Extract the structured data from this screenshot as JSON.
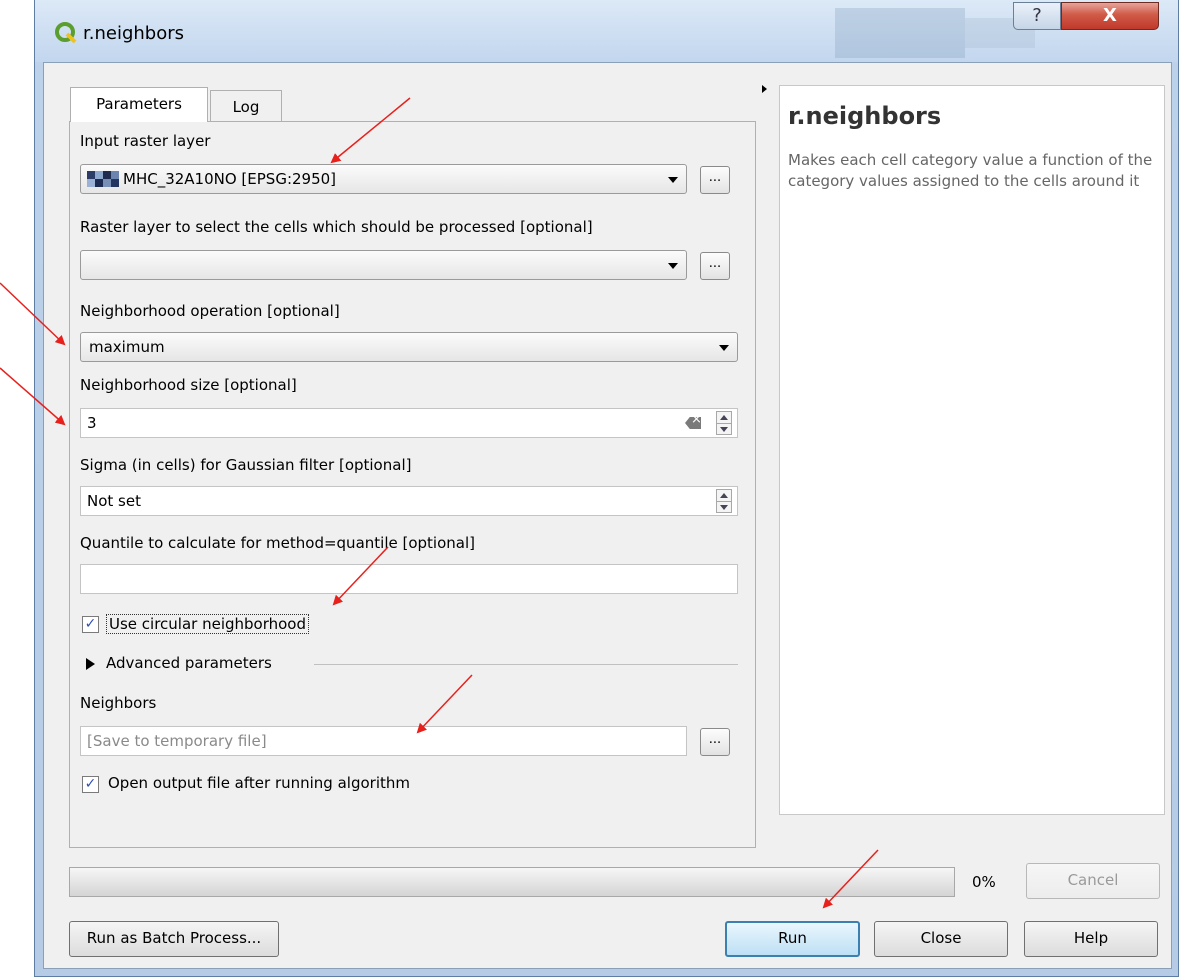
{
  "window": {
    "title": "r.neighbors",
    "help_button_label": "?",
    "close_button_label": "X"
  },
  "tabs": [
    {
      "label": "Parameters",
      "active": true
    },
    {
      "label": "Log",
      "active": false
    }
  ],
  "params": {
    "input_raster_label": "Input raster layer",
    "input_raster_value": "MHC_32A10NO [EPSG:2950]",
    "selection_label": "Raster layer to select the cells which should be processed [optional]",
    "selection_value": "",
    "operation_label": "Neighborhood operation [optional]",
    "operation_value": "maximum",
    "size_label": "Neighborhood size [optional]",
    "size_value": "3",
    "sigma_label": "Sigma (in cells) for Gaussian filter [optional]",
    "sigma_value": "Not set",
    "quantile_label": "Quantile to calculate for method=quantile [optional]",
    "quantile_value": "",
    "circular_label": "Use circular neighborhood",
    "circular_checked": true,
    "advanced_label": "Advanced parameters",
    "neighbors_label": "Neighbors",
    "neighbors_placeholder": "[Save to temporary file]",
    "open_output_label": "Open output file after running algorithm",
    "open_output_checked": true,
    "browse_label": "..."
  },
  "help": {
    "title": "r.neighbors",
    "description": "Makes each cell category value a function of the category values assigned to the cells around it"
  },
  "progress": {
    "value": 0,
    "text": "0%"
  },
  "buttons": {
    "cancel": "Cancel",
    "batch": "Run as Batch Process...",
    "run": "Run",
    "close": "Close",
    "help": "Help"
  },
  "colors": {
    "annotation_arrow": "#e8201c",
    "qgis_green": "#5b9e2f",
    "close_red": "#c0392b"
  }
}
